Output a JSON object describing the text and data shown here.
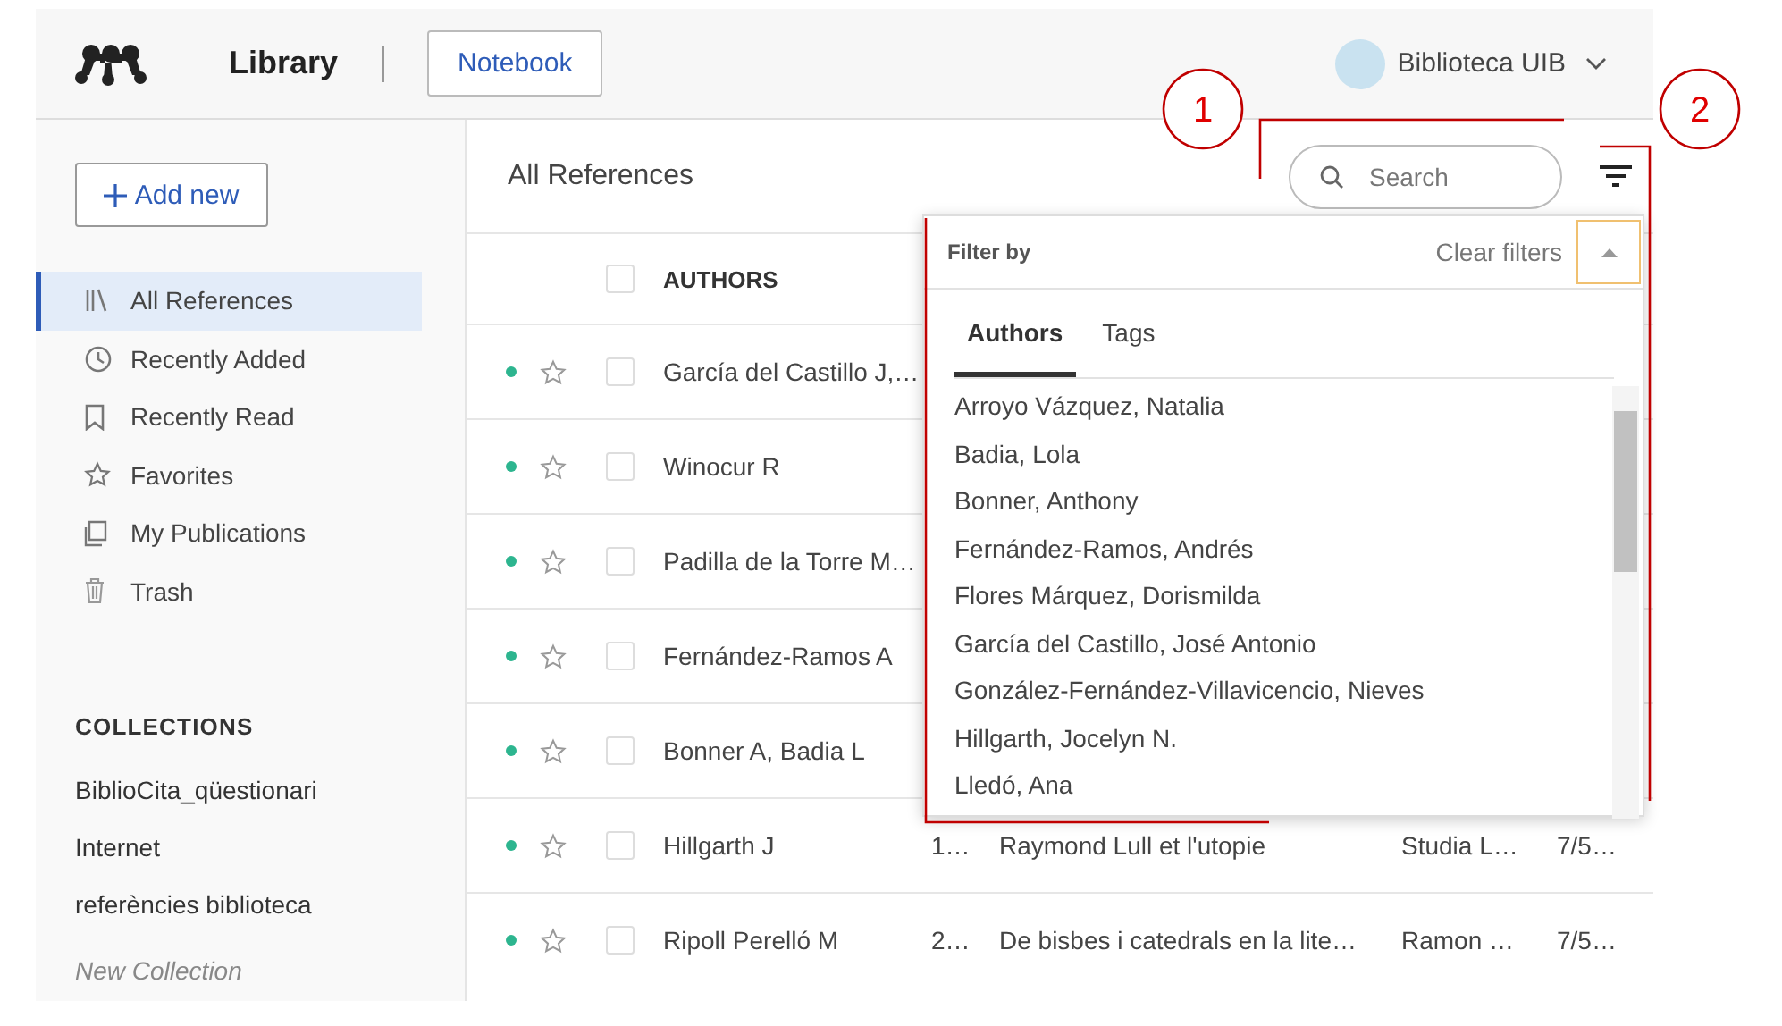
{
  "header": {
    "title": "Library",
    "notebook_button": "Notebook",
    "account": "Biblioteca UIB"
  },
  "sidebar": {
    "add_button": "Add new",
    "items": [
      {
        "kind": "all",
        "label": "All References",
        "selected": true
      },
      {
        "kind": "added",
        "label": "Recently Added",
        "selected": false
      },
      {
        "kind": "read",
        "label": "Recently Read",
        "selected": false
      },
      {
        "kind": "favorites",
        "label": "Favorites",
        "selected": false
      },
      {
        "kind": "publications",
        "label": "My Publications",
        "selected": false
      },
      {
        "kind": "trash",
        "label": "Trash",
        "selected": false
      }
    ],
    "collections_heading": "COLLECTIONS",
    "collections": [
      "BiblioCita_qüestionari",
      "Internet",
      "referències biblioteca"
    ],
    "new_collection": "New Collection"
  },
  "main": {
    "title": "All References",
    "search": {
      "placeholder": "Search"
    },
    "table": {
      "select_all": {
        "checked": false
      },
      "columns": [
        "AUTHORS"
      ],
      "rows": [
        {
          "authors": "García del Castillo J,…",
          "unread": true,
          "favorite": false,
          "checked": false
        },
        {
          "authors": "Winocur R",
          "unread": true,
          "favorite": false,
          "checked": false
        },
        {
          "authors": "Padilla de la Torre M…",
          "unread": true,
          "favorite": false,
          "checked": false
        },
        {
          "authors": "Fernández-Ramos A",
          "unread": true,
          "favorite": false,
          "checked": false
        },
        {
          "authors": "Bonner A, Badia L",
          "unread": true,
          "favorite": false,
          "checked": false
        },
        {
          "authors": "Hillgarth J",
          "year": "1…",
          "title": "Raymond Lull et l'utopie",
          "source": "Studia L…",
          "added": "7/5…",
          "unread": true,
          "favorite": false,
          "checked": false
        },
        {
          "authors": "Ripoll Perelló M",
          "year": "2…",
          "title": "De bisbes i catedrals en la lite…",
          "source": "Ramon …",
          "added": "7/5…",
          "unread": true,
          "favorite": false,
          "checked": false
        }
      ]
    }
  },
  "filter_panel": {
    "heading": "Filter by",
    "clear": "Clear filters",
    "tabs": [
      {
        "label": "Authors",
        "selected": true
      },
      {
        "label": "Tags",
        "selected": false
      }
    ],
    "authors": [
      "Arroyo Vázquez, Natalia",
      "Badia, Lola",
      "Bonner, Anthony",
      "Fernández-Ramos, Andrés",
      "Flores Márquez, Dorismilda",
      "García del Castillo, José Antonio",
      "González-Fernández-Villavicencio, Nieves",
      "Hillgarth, Jocelyn N.",
      "Lledó, Ana"
    ]
  },
  "callouts": [
    {
      "label": "1"
    },
    {
      "label": "2"
    }
  ]
}
